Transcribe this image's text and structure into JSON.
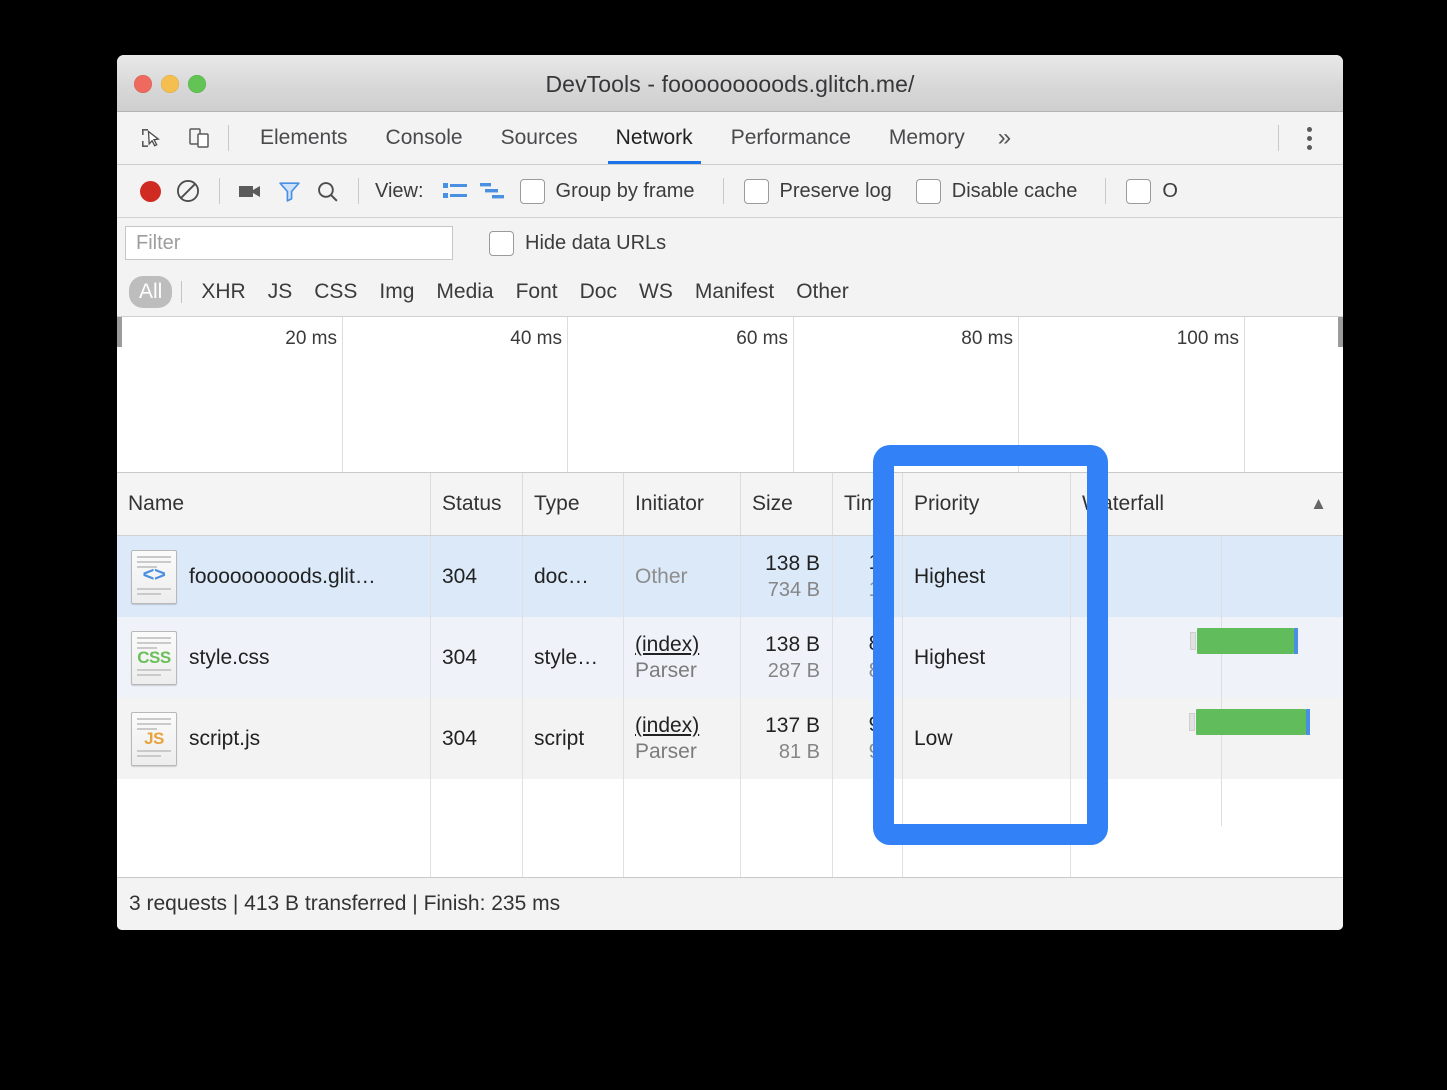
{
  "window": {
    "title": "DevTools - fooooooooods.glitch.me/",
    "traffic_lights": [
      "close",
      "minimize",
      "maximize"
    ]
  },
  "tabbar": {
    "icons": [
      "inspect-element-icon",
      "device-toolbar-icon"
    ],
    "tabs": [
      {
        "label": "Elements",
        "active": false
      },
      {
        "label": "Console",
        "active": false
      },
      {
        "label": "Sources",
        "active": false
      },
      {
        "label": "Network",
        "active": true
      },
      {
        "label": "Performance",
        "active": false
      },
      {
        "label": "Memory",
        "active": false
      }
    ],
    "more_label": "»",
    "menu_icon": "kebab-menu-icon"
  },
  "network_toolbar": {
    "record_icon": "record-button-icon",
    "clear_icon": "clear-icon",
    "filmstrip_icon": "camera-icon",
    "filter_icon": "funnel-icon",
    "search_icon": "search-icon",
    "view_label": "View:",
    "view_list_icon": "list-view-icon",
    "view_waterfall_icon": "waterfall-view-icon",
    "checkboxes": [
      {
        "label": "Group by frame",
        "checked": false
      },
      {
        "label": "Preserve log",
        "checked": false
      },
      {
        "label": "Disable cache",
        "checked": false
      },
      {
        "label": "O",
        "checked": false
      }
    ]
  },
  "filterbar": {
    "filter_placeholder": "Filter",
    "filter_value": "",
    "hide_data_urls": {
      "label": "Hide data URLs",
      "checked": false
    }
  },
  "type_filters": {
    "items": [
      "All",
      "XHR",
      "JS",
      "CSS",
      "Img",
      "Media",
      "Font",
      "Doc",
      "WS",
      "Manifest",
      "Other"
    ],
    "selected": "All"
  },
  "overview": {
    "ticks": [
      "20 ms",
      "40 ms",
      "60 ms",
      "80 ms",
      "100 ms"
    ]
  },
  "table": {
    "columns": [
      "Name",
      "Status",
      "Type",
      "Initiator",
      "Size",
      "Time",
      "Priority",
      "Waterfall"
    ],
    "sort_indicator": "▲",
    "rows": [
      {
        "icon": "document-file-icon",
        "icon_glyph": "<>",
        "name": "fooooooooods.glit…",
        "status": "304",
        "type": "doc…",
        "initiator": "Other",
        "initiator_sub": "",
        "initiator_is_link": false,
        "size": "138 B",
        "size_sub": "734 B",
        "time": "12",
        "time_sub": "12",
        "priority": "Highest",
        "selected": true
      },
      {
        "icon": "css-file-icon",
        "icon_glyph": "CSS",
        "name": "style.css",
        "status": "304",
        "type": "style…",
        "initiator": "(index)",
        "initiator_sub": "Parser",
        "initiator_is_link": true,
        "size": "138 B",
        "size_sub": "287 B",
        "time": "89",
        "time_sub": "88",
        "priority": "Highest",
        "selected": false
      },
      {
        "icon": "js-file-icon",
        "icon_glyph": "JS",
        "name": "script.js",
        "status": "304",
        "type": "script",
        "initiator": "(index)",
        "initiator_sub": "Parser",
        "initiator_is_link": true,
        "size": "137 B",
        "size_sub": "81 B",
        "time": "95",
        "time_sub": "95",
        "priority": "Low",
        "selected": false
      }
    ]
  },
  "footer": {
    "summary": "3 requests | 413 B transferred | Finish: 235 ms"
  },
  "annotation": {
    "target_column": "Priority",
    "color": "#3281f6"
  },
  "colors": {
    "accent": "#1a73e8",
    "annotation_blue": "#3281f6",
    "waterfall_green": "#61bd5b",
    "record_red": "#cf2b22",
    "selected_row": "#dbe9f9"
  }
}
